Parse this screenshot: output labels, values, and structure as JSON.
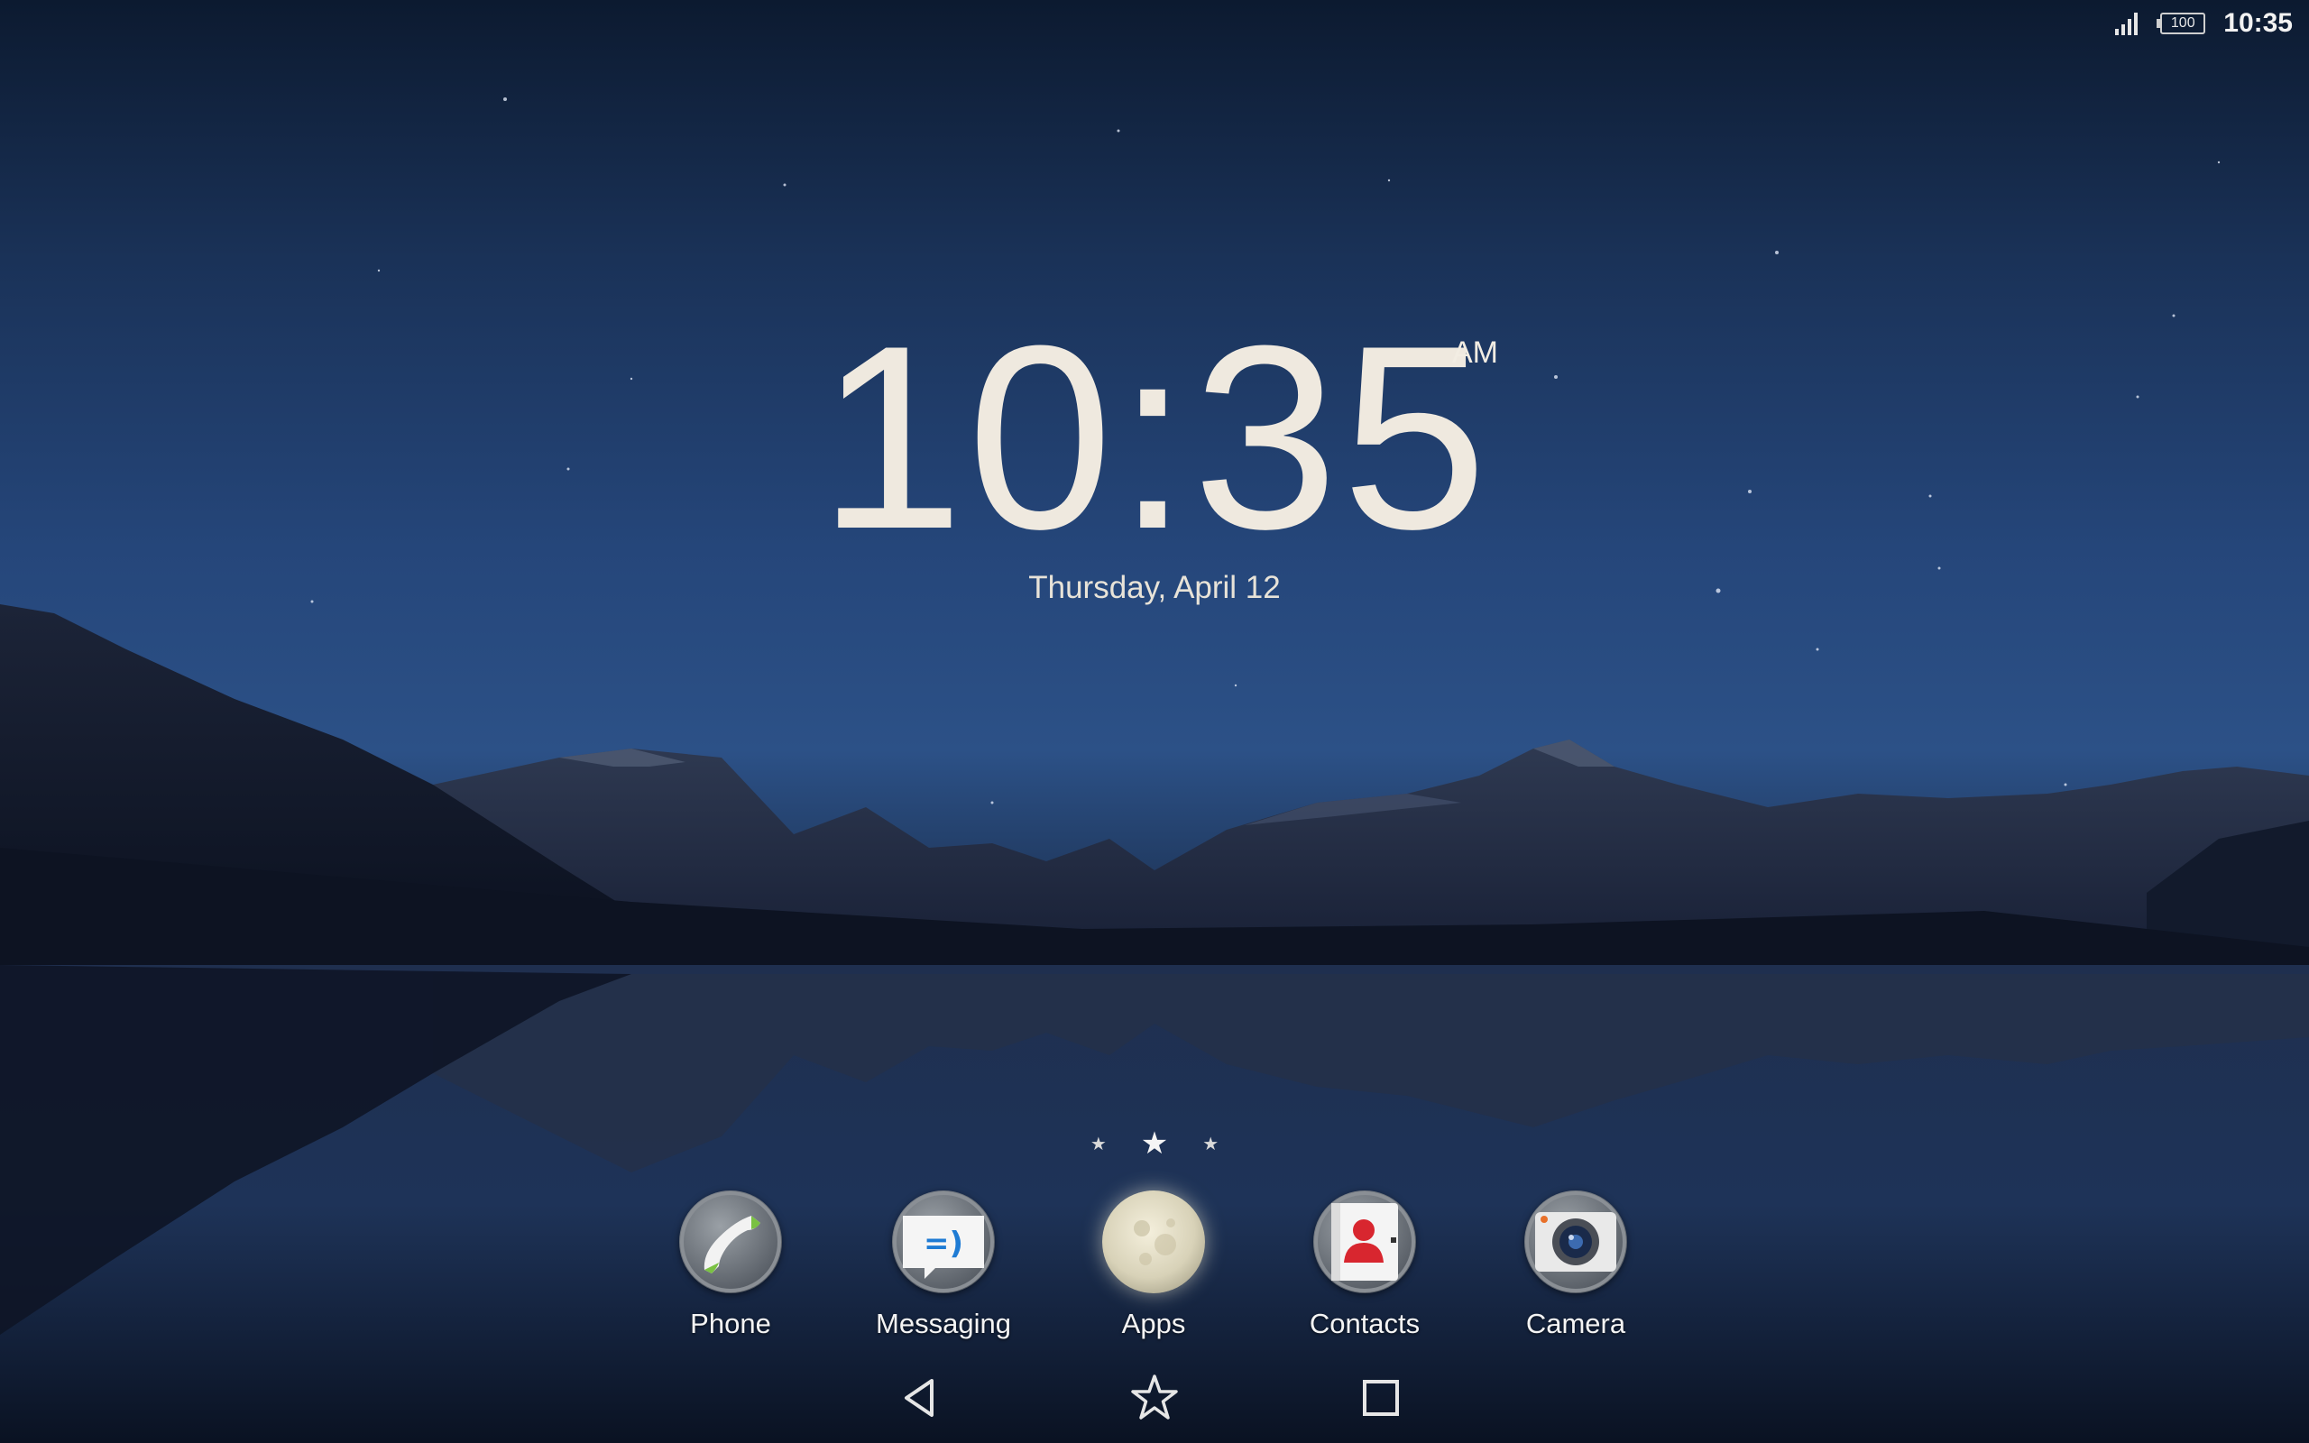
{
  "status_bar": {
    "signal_icon": "signal-bars-icon",
    "battery_level": "100",
    "time": "10:35"
  },
  "clock": {
    "time": "10:35",
    "ampm": "AM",
    "date": "Thursday, April 12"
  },
  "page_indicator": {
    "pages": 3,
    "active_index": 1
  },
  "dock": {
    "apps": [
      {
        "label": "Phone",
        "icon": "phone-icon"
      },
      {
        "label": "Messaging",
        "icon": "messaging-icon"
      },
      {
        "label": "Apps",
        "icon": "apps-icon"
      },
      {
        "label": "Contacts",
        "icon": "contacts-icon"
      },
      {
        "label": "Camera",
        "icon": "camera-icon"
      }
    ]
  },
  "nav_bar": {
    "back": "back-icon",
    "home": "home-star-icon",
    "recents": "recents-icon"
  }
}
